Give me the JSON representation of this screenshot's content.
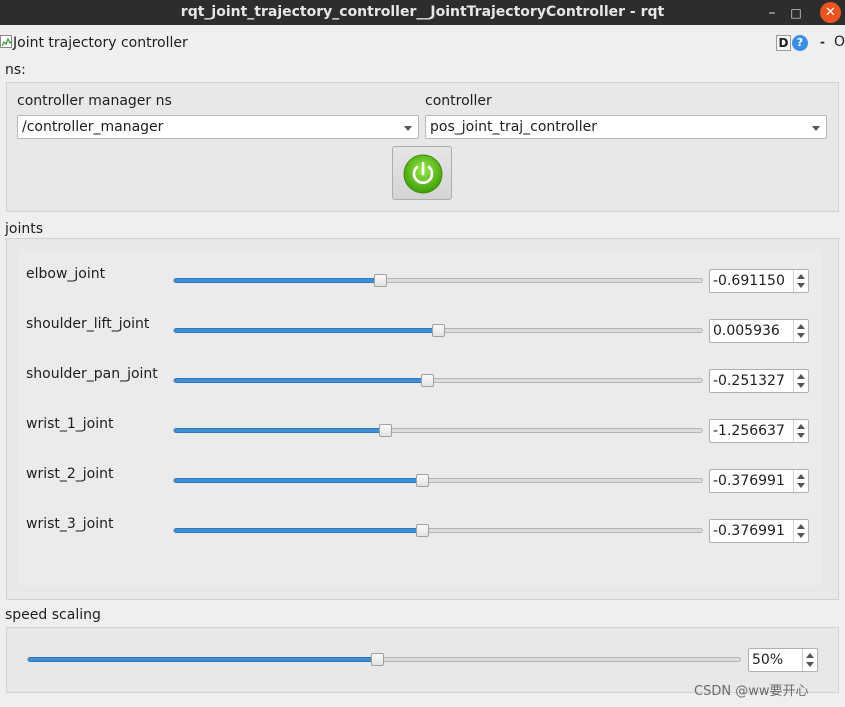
{
  "window": {
    "title": "rqt_joint_trajectory_controller__JointTrajectoryController - rqt",
    "minimize_glyph": "–",
    "maximize_glyph": "□",
    "close_glyph": "✕"
  },
  "plugin": {
    "title": "Joint trajectory controller",
    "d_button": "D",
    "help_glyph": "?",
    "dash_glyph": "-",
    "o_glyph": "O"
  },
  "ns_section": {
    "label": "ns:",
    "controller_manager_label": "controller manager ns",
    "controller_manager_value": "/controller_manager",
    "controller_label": "controller",
    "controller_value": "pos_joint_traj_controller"
  },
  "joints_section": {
    "label": "joints",
    "joints": [
      {
        "name": "elbow_joint",
        "value": "-0.691150",
        "slider_fraction": 0.39
      },
      {
        "name": "shoulder_lift_joint",
        "value": "0.005936",
        "slider_fraction": 0.5
      },
      {
        "name": "shoulder_pan_joint",
        "value": "-0.251327",
        "slider_fraction": 0.48
      },
      {
        "name": "wrist_1_joint",
        "value": "-1.256637",
        "slider_fraction": 0.4
      },
      {
        "name": "wrist_2_joint",
        "value": "-0.376991",
        "slider_fraction": 0.47
      },
      {
        "name": "wrist_3_joint",
        "value": "-0.376991",
        "slider_fraction": 0.47
      }
    ]
  },
  "speed_section": {
    "label": "speed scaling",
    "value": "50%",
    "slider_fraction": 0.49
  },
  "watermark": "CSDN @ww要开心",
  "colors": {
    "accent": "#3d8fd6",
    "power": "#5cc20f",
    "titlebar": "#2d2d2d",
    "close": "#e95420"
  },
  "icons": [
    "plot-icon",
    "power-icon",
    "help-icon",
    "dropdown-arrow-icon"
  ]
}
